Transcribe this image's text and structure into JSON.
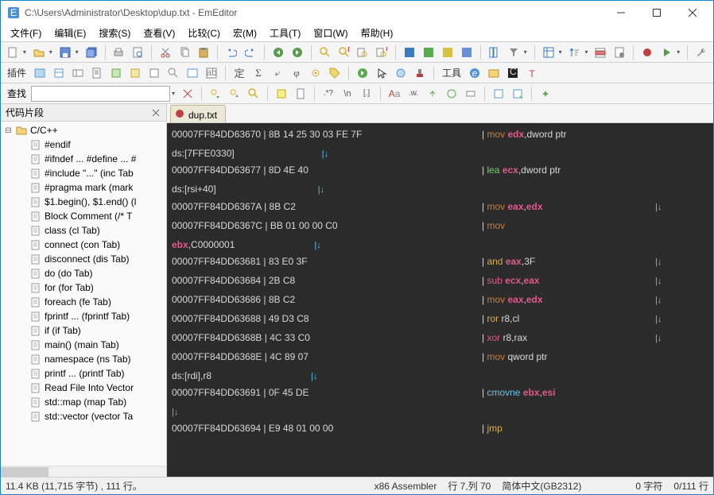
{
  "window": {
    "title": "C:\\Users\\Administrator\\Desktop\\dup.txt - EmEditor"
  },
  "menu": {
    "file": "文件(F)",
    "edit": "编辑(E)",
    "search": "搜索(S)",
    "view": "查看(V)",
    "compare": "比较(C)",
    "macro": "宏(M)",
    "tools": "工具(T)",
    "window": "窗口(W)",
    "help": "帮助(H)"
  },
  "toolbar2": {
    "plugins_label": "插件",
    "tools_label": "工具"
  },
  "search": {
    "label": "查找",
    "value": ""
  },
  "sidebar": {
    "title": "代码片段",
    "root": "C/C++",
    "items": [
      "#endif",
      "#ifndef ... #define ... #",
      "#include \"...\"  (inc Tab",
      "#pragma mark  (mark",
      "$1.begin(), $1.end()  (l",
      "Block Comment  (/* T",
      "class  (cl Tab)",
      "connect  (con Tab)",
      "disconnect  (dis Tab)",
      "do  (do Tab)",
      "for  (for Tab)",
      "foreach  (fe Tab)",
      "fprintf ...  (fprintf Tab)",
      "if  (if Tab)",
      "main()  (main Tab)",
      "namespace  (ns Tab)",
      "printf ...  (printf Tab)",
      "Read File Into Vector",
      "std::map  (map Tab)",
      "std::vector  (vector Ta"
    ]
  },
  "tab": {
    "name": "dup.txt"
  },
  "code": {
    "lines": [
      {
        "addr": "00007FF84DD63670",
        "hex": "8B 14 25 30 03 FE 7F",
        "op": "mov",
        "opc": "op-mov",
        "args_pre": "",
        "reg": "edx",
        "args_post": ",dword ptr",
        "cont": true
      },
      {
        "cont_text": "ds:[7FFE0330]",
        "lf_after_gap": 110,
        "lf": true
      },
      {
        "addr": "00007FF84DD63677",
        "hex": "8D 4E 40",
        "op": "lea",
        "opc": "op-lea",
        "args_pre": "",
        "reg": "ecx",
        "args_post": ",dword ptr",
        "cont": true
      },
      {
        "cont_text": "ds:[rsi+40]",
        "lf_after_gap": 128,
        "lf": true
      },
      {
        "addr": "00007FF84DD63681",
        "hex_pad": 0,
        "hex": "",
        "noop": true
      },
      {
        "addr": "00007FF84DD6367A",
        "hex": "8B C2",
        "op": "mov",
        "opc": "op-mov",
        "args_pre": "",
        "reg": "eax",
        "reg2": "edx",
        "args_post": "",
        "tail_lf": true
      },
      {
        "addr": "00007FF84DD6367C",
        "hex": "BB 01 00 00 C0",
        "op": "mov",
        "opc": "op-mov",
        "args_pre": "",
        "reg": "",
        "args_post": "",
        "cont": true,
        "op_only": true
      },
      {
        "cont_reg": "ebx",
        "cont_text2": ",C0000001",
        "lf_after_gap": 100,
        "lf": true
      },
      {
        "addr": "00007FF84DD63681",
        "hex": "83 E0 3F",
        "op": "and",
        "opc": "op-and",
        "args_pre": "",
        "reg": "eax",
        "args_post": ",3F",
        "tail_lf": true
      },
      {
        "addr": "00007FF84DD63684",
        "hex": "2B C8",
        "op": "sub",
        "opc": "op-sub",
        "args_pre": "",
        "reg": "ecx",
        "reg2": "eax",
        "args_post": "",
        "tail_lf": true
      },
      {
        "addr": "00007FF84DD63686",
        "hex": "8B C2",
        "op": "mov",
        "opc": "op-mov",
        "args_pre": "",
        "reg": "eax",
        "reg2": "edx",
        "args_post": "",
        "tail_lf": true
      },
      {
        "addr": "00007FF84DD63688",
        "hex": "49 D3 C8",
        "op": "ror",
        "opc": "op-ror",
        "args_pre": " ",
        "plain": "r8,cl",
        "tail_lf": true
      },
      {
        "addr": "00007FF84DD6368B",
        "hex": "4C 33 C0",
        "op": "xor",
        "opc": "op-xor",
        "args_pre": " ",
        "plain": "r8,rax",
        "tail_lf": true
      },
      {
        "addr": "00007FF84DD6368E",
        "hex": "4C 89 07",
        "op": "mov",
        "opc": "op-mov",
        "args_pre": " ",
        "plain": "qword ptr",
        "cont": true
      },
      {
        "cont_text": "ds:[rdi],r8",
        "lf_after_gap": 125,
        "lf": true
      },
      {
        "addr": "00007FF84DD63691",
        "hex": "0F 45 DE",
        "op": "cmovne",
        "opc": "op-cmovne",
        "args_pre": " ",
        "reg": "ebx",
        "reg2": "esi",
        "args_post": "",
        "cont": true
      },
      {
        "cont_lf_only": true
      },
      {
        "addr": "00007FF84DD63694",
        "hex": "E9 48 01 00 00",
        "op": "jmp",
        "opc": "op-jmp",
        "args_pre": "",
        "plain": ""
      }
    ]
  },
  "status": {
    "size": "11.4 KB (11,715 字节) , 111 行。",
    "lang": "x86 Assembler",
    "pos": "行 7,列 70",
    "enc": "简体中文(GB2312)",
    "chars": "0 字符",
    "lines": "0/111 行"
  }
}
